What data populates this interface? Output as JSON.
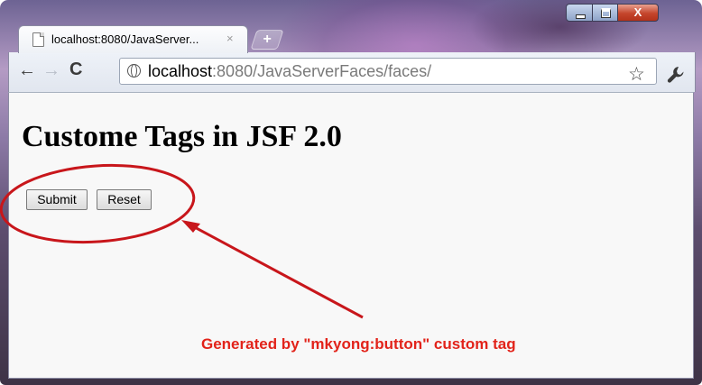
{
  "browser": {
    "tab": {
      "title": "localhost:8080/JavaServer...",
      "close_icon": "×"
    },
    "new_tab_icon": "+",
    "window_controls": {
      "minimize_icon": "minimize-icon",
      "maximize_icon": "maximize-icon",
      "close_icon": "X"
    },
    "toolbar": {
      "back_icon": "←",
      "forward_icon": "→",
      "reload_icon": "C",
      "address": {
        "host": "localhost",
        "rest": ":8080/JavaServerFaces/faces/"
      },
      "star_icon": "☆",
      "wrench_icon": "wrench-icon"
    }
  },
  "page": {
    "heading": "Custome Tags in JSF 2.0",
    "buttons": {
      "submit": "Submit",
      "reset": "Reset"
    },
    "annotation": {
      "text": "Generated by \"mkyong:button\" custom tag",
      "color": "#e2231a"
    }
  }
}
